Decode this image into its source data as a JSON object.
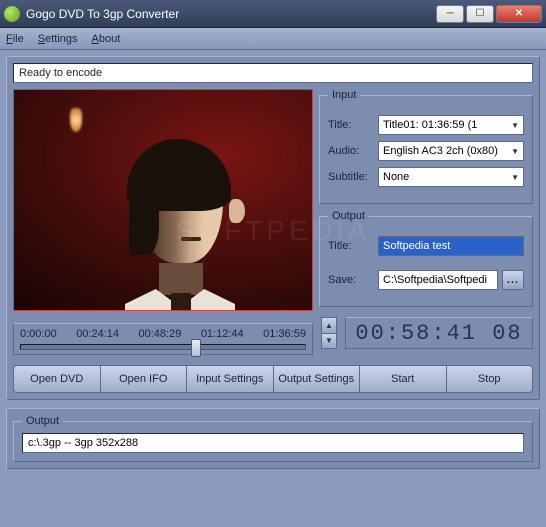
{
  "window": {
    "title": "Gogo DVD To 3gp Converter"
  },
  "menu": {
    "file": "File",
    "settings": "Settings",
    "about": "About"
  },
  "status": "Ready to encode",
  "input": {
    "legend": "Input",
    "title_label": "Title:",
    "title_value": "Title01: 01:36:59     (1",
    "audio_label": "Audio:",
    "audio_value": "English AC3 2ch (0x80)",
    "subtitle_label": "Subtitle:",
    "subtitle_value": "None"
  },
  "output": {
    "legend": "Output",
    "title_label": "Title:",
    "title_value": "Softpedia test",
    "save_label": "Save:",
    "save_value": "C:\\Softpedia\\Softpedi"
  },
  "timeline": {
    "t0": "0:00:00",
    "t1": "00:24:14",
    "t2": "00:48:29",
    "t3": "01:12:44",
    "t4": "01:36:59"
  },
  "lcd": "00:58:41 08",
  "buttons": {
    "open_dvd": "Open DVD",
    "open_ifo": "Open IFO",
    "input_settings": "Input Settings",
    "output_settings": "Output Settings",
    "start": "Start",
    "stop": "Stop"
  },
  "bottom": {
    "legend": "Output",
    "value": "c:\\.3gp -- 3gp 352x288"
  },
  "browse": "..."
}
